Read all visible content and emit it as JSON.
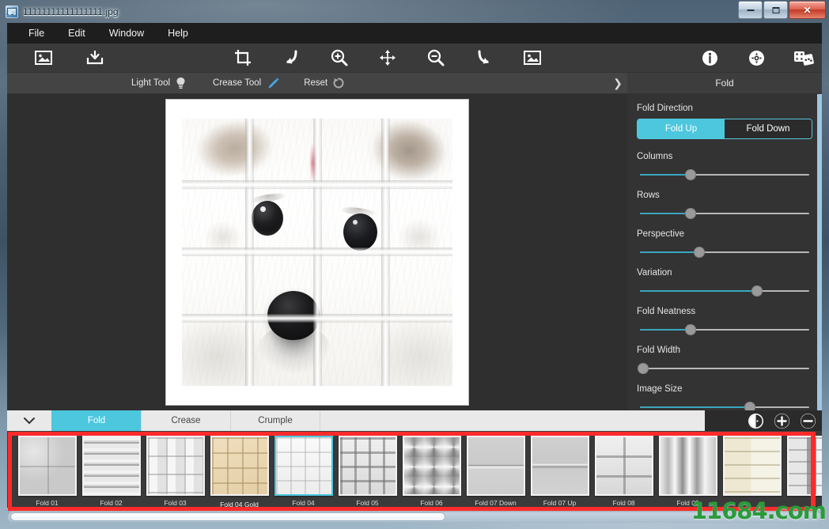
{
  "window": {
    "title": "11111111111111111.jpg",
    "icon": "image-file-icon",
    "minimize_label": "–",
    "maximize_label": "□",
    "close_label": "✕"
  },
  "menubar": {
    "items": [
      {
        "label": "File"
      },
      {
        "label": "Edit"
      },
      {
        "label": "Window"
      },
      {
        "label": "Help"
      }
    ]
  },
  "toolbar": {
    "buttons": [
      {
        "name": "open-image-button",
        "icon": "image-frame-icon"
      },
      {
        "name": "save-image-button",
        "icon": "save-tray-icon"
      },
      {
        "name": "crop-button",
        "icon": "crop-icon"
      },
      {
        "name": "undo-button",
        "icon": "undo-arrow-icon"
      },
      {
        "name": "zoom-in-button",
        "icon": "zoom-in-icon"
      },
      {
        "name": "pan-button",
        "icon": "move-arrows-icon"
      },
      {
        "name": "zoom-out-button",
        "icon": "zoom-out-icon"
      },
      {
        "name": "redo-button",
        "icon": "redo-arrow-icon"
      },
      {
        "name": "fit-image-button",
        "icon": "image-fit-icon"
      },
      {
        "name": "info-button",
        "icon": "info-circle-icon"
      },
      {
        "name": "settings-button",
        "icon": "gear-circle-icon"
      },
      {
        "name": "randomize-button",
        "icon": "dice-icon"
      }
    ]
  },
  "subbar": {
    "light_tool": "Light Tool",
    "crease_tool": "Crease Tool",
    "reset": "Reset",
    "expand_arrow": "❯",
    "panel_title": "Fold"
  },
  "panel": {
    "fold_direction_label": "Fold Direction",
    "fold_up": "Fold Up",
    "fold_down": "Fold Down",
    "active_direction": "Fold Up",
    "accent_color": "#4cc7de",
    "sliders": [
      {
        "label": "Columns",
        "value": 30
      },
      {
        "label": "Rows",
        "value": 30
      },
      {
        "label": "Perspective",
        "value": 35
      },
      {
        "label": "Variation",
        "value": 69
      },
      {
        "label": "Fold Neatness",
        "value": 30
      },
      {
        "label": "Fold Width",
        "value": 2
      },
      {
        "label": "Image Size",
        "value": 65
      }
    ]
  },
  "canvas": {
    "image_alt": "white puppy face",
    "grid_columns": 4,
    "grid_rows": 4
  },
  "bottom": {
    "collapse_icon": "chevron-down-icon",
    "tabs": [
      {
        "label": "Fold",
        "active": true
      },
      {
        "label": "Crease",
        "active": false
      },
      {
        "label": "Crumple",
        "active": false
      }
    ],
    "actions": [
      {
        "name": "preset-options-button",
        "icon": "preset-bubble-icon",
        "glyph": "◔"
      },
      {
        "name": "add-preset-button",
        "icon": "plus-circle-icon",
        "glyph": "+"
      },
      {
        "name": "remove-preset-button",
        "icon": "minus-circle-icon",
        "glyph": "−"
      }
    ],
    "presets": [
      {
        "label": "Fold 01",
        "style": "quad",
        "selected": false,
        "tall": false
      },
      {
        "label": "Fold 02",
        "style": "rows",
        "selected": false,
        "tall": false
      },
      {
        "label": "Fold 03",
        "style": "grid3",
        "selected": false,
        "tall": false
      },
      {
        "label": "Fold 04 Gold",
        "style": "gold",
        "selected": false,
        "tall": true
      },
      {
        "label": "Fold 04",
        "style": "grid4soft",
        "selected": true,
        "tall": false
      },
      {
        "label": "Fold 05",
        "style": "grid4",
        "selected": false,
        "tall": false
      },
      {
        "label": "Fold 06",
        "style": "checker",
        "selected": false,
        "tall": false
      },
      {
        "label": "Fold 07 Down",
        "style": "halfdown",
        "selected": false,
        "tall": false
      },
      {
        "label": "Fold 07 Up",
        "style": "halfup",
        "selected": false,
        "tall": false
      },
      {
        "label": "Fold 08",
        "style": "sixpanel",
        "selected": false,
        "tall": false
      },
      {
        "label": "Fold 09",
        "style": "vertical",
        "selected": false,
        "tall": false
      },
      {
        "label": "",
        "style": "goldrows",
        "selected": false,
        "tall": false
      },
      {
        "label": "",
        "style": "mixed",
        "selected": false,
        "tall": false
      }
    ]
  },
  "annotation": {
    "highlight_color": "#ff2b2b"
  },
  "watermark": {
    "text": "11684.com",
    "color": "#2a9b3a"
  }
}
